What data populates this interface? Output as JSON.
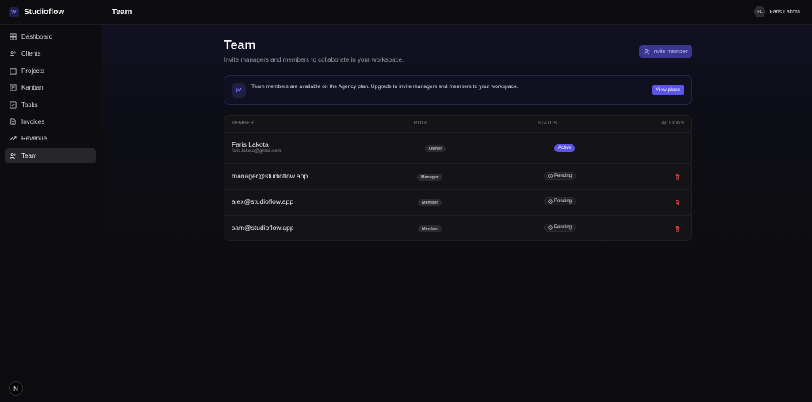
{
  "app": {
    "brand": "Studioflow",
    "page_title_bar": "Team"
  },
  "user": {
    "initials": "FL",
    "name": "Faris Lakota"
  },
  "sidebar": {
    "items": [
      {
        "label": "Dashboard",
        "icon": "dashboard-icon"
      },
      {
        "label": "Clients",
        "icon": "users-icon"
      },
      {
        "label": "Projects",
        "icon": "folder-icon"
      },
      {
        "label": "Kanban",
        "icon": "kanban-icon"
      },
      {
        "label": "Tasks",
        "icon": "checkbox-icon"
      },
      {
        "label": "Invoices",
        "icon": "file-icon"
      },
      {
        "label": "Revenue",
        "icon": "trend-icon"
      },
      {
        "label": "Team",
        "icon": "team-icon",
        "active": true
      }
    ],
    "footer_badge": "N"
  },
  "page": {
    "title": "Team",
    "subtitle": "Invite managers and members to collaborate in your workspace.",
    "invite_label": "Invite member"
  },
  "banner": {
    "text": "Team members are available on the Agency plan. Upgrade to invite managers and members to your workspace.",
    "button": "View plans"
  },
  "table": {
    "headers": {
      "member": "MEMBER",
      "role": "ROLE",
      "status": "STATUS",
      "actions": "ACTIONS"
    },
    "rows": [
      {
        "name": "Faris Lakota",
        "email": "faris.lakota@gmail.com",
        "role": "Owner",
        "status": "Active"
      },
      {
        "name": "manager@studioflow.app",
        "role": "Manager",
        "status": "Pending"
      },
      {
        "name": "alex@studioflow.app",
        "role": "Member",
        "status": "Pending"
      },
      {
        "name": "sam@studioflow.app",
        "role": "Member",
        "status": "Pending"
      }
    ]
  },
  "colors": {
    "accent": "#5b55e6",
    "danger": "#e5484d",
    "background": "#0c0c0e"
  }
}
